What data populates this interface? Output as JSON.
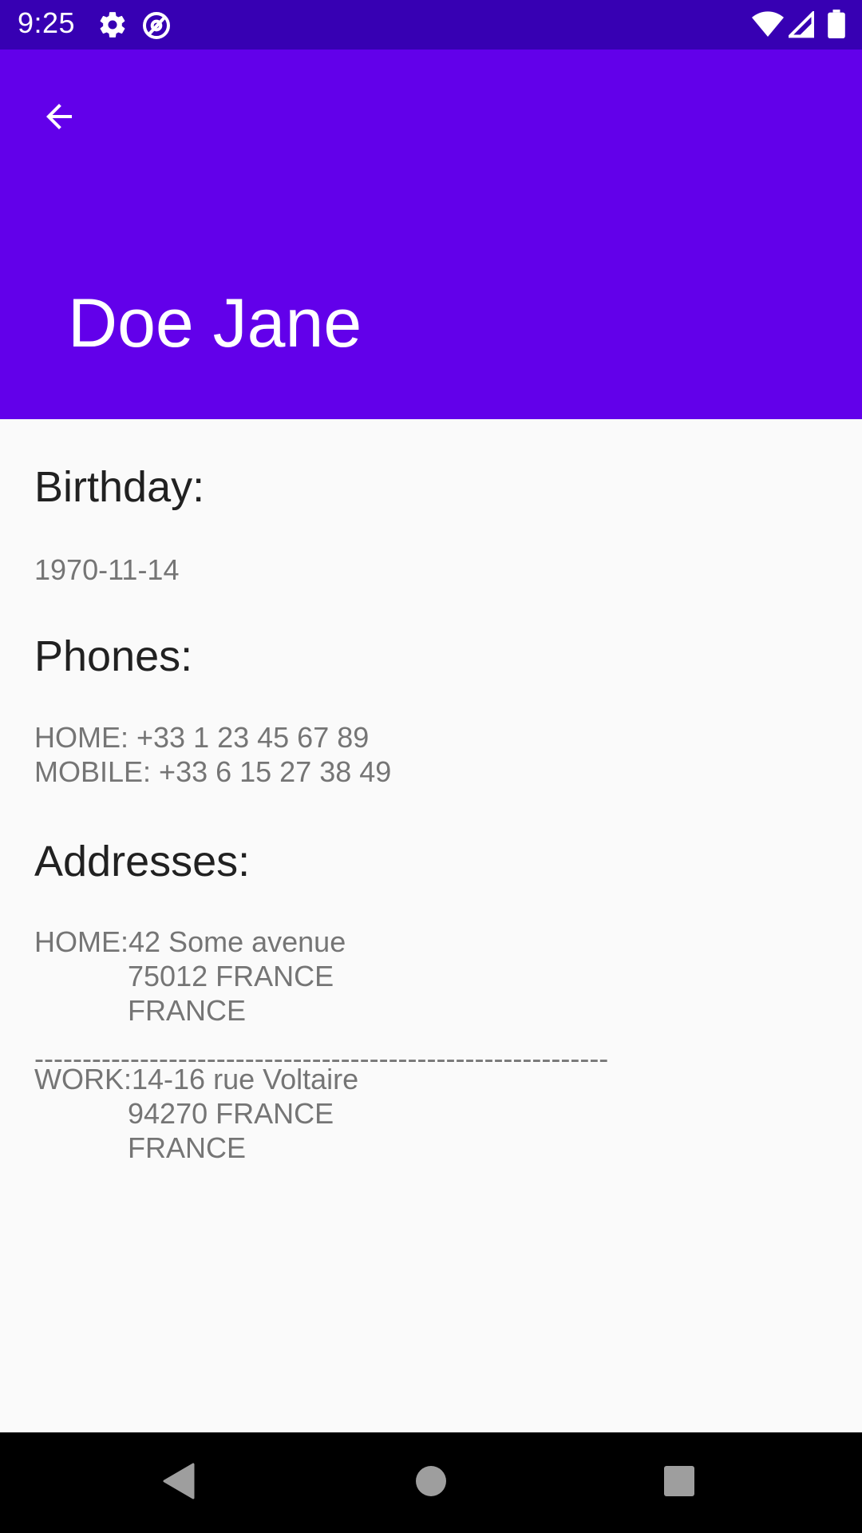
{
  "status_bar": {
    "time": "9:25",
    "icons": [
      "gear-icon",
      "at-sign-icon",
      "wifi-icon",
      "signal-icon",
      "battery-icon"
    ]
  },
  "app_bar": {
    "title": "Doe Jane",
    "back_icon": "arrow-back-icon",
    "background": "#6200ea",
    "status_bar_background": "#3700b3"
  },
  "birthday": {
    "heading": "Birthday:",
    "value": "1970-11-14"
  },
  "phones": {
    "heading": "Phones:",
    "items": [
      "HOME: +33 1 23 45 67 89",
      "MOBILE: +33 6 15 27 38 49"
    ]
  },
  "addresses": {
    "heading": "Addresses:",
    "separator": "------------------------------------------------------------",
    "items": [
      {
        "type": "HOME:",
        "street": "42 Some avenue",
        "city": "75012 FRANCE",
        "country": "FRANCE"
      },
      {
        "type": "WORK:",
        "street": "14-16 rue Voltaire",
        "city": "94270 FRANCE",
        "country": "FRANCE"
      }
    ]
  },
  "nav_bar": {
    "icons": [
      "back-triangle-icon",
      "home-circle-icon",
      "recents-square-icon"
    ]
  }
}
